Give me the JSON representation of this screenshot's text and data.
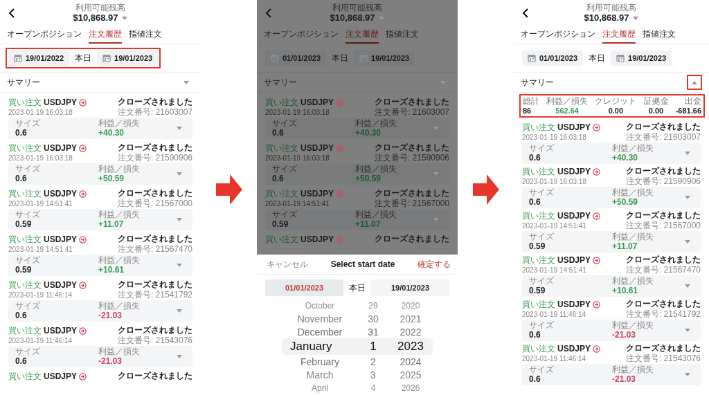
{
  "screens": [
    {
      "dimmed": false,
      "header": {
        "label": "利用可能残高",
        "balance": "$10,868.97"
      },
      "tabs": [
        {
          "label": "オープンポジション",
          "selected": false
        },
        {
          "label": "注文履歴",
          "selected": true
        },
        {
          "label": "指値注文",
          "selected": false
        }
      ],
      "date_range": {
        "start": "19/01/2022",
        "today": "本日",
        "end": "19/01/2023",
        "highlighted": true
      },
      "summary": {
        "label": "サマリー",
        "expanded": false,
        "toggle_highlighted": false
      },
      "orders": [
        {
          "side": "買い注文",
          "symbol": "USDJPY",
          "time": "2023-01-19 16:03:18",
          "status": "クローズされました",
          "order_no": "注文番号: 21603007",
          "size_label": "サイズ",
          "size": "0.6",
          "pl_label": "利益／損失",
          "pl": "+40.30",
          "color": "#3c9a55"
        },
        {
          "side": "買い注文",
          "symbol": "USDJPY",
          "time": "2023-01-19 16:03:18",
          "status": "クローズされました",
          "order_no": "注文番号: 21590906",
          "size_label": "サイズ",
          "size": "0.6",
          "pl_label": "利益／損失",
          "pl": "+50.59",
          "color": "#3c9a55"
        },
        {
          "side": "買い注文",
          "symbol": "USDJPY",
          "time": "2023-01-19 14:51:41",
          "status": "クローズされました",
          "order_no": "注文番号: 21567000",
          "size_label": "サイズ",
          "size": "0.59",
          "pl_label": "利益／損失",
          "pl": "+11.07",
          "color": "#3c9a55"
        },
        {
          "side": "買い注文",
          "symbol": "USDJPY",
          "time": "2023-01-19 14:51:41",
          "status": "クローズされました",
          "order_no": "注文番号: 21567470",
          "size_label": "サイズ",
          "size": "0.59",
          "pl_label": "利益／損失",
          "pl": "+10.61",
          "color": "#3c9a55"
        },
        {
          "side": "買い注文",
          "symbol": "USDJPY",
          "time": "2023-01-19 11:46:14",
          "status": "クローズされました",
          "order_no": "注文番号: 21541792",
          "size_label": "サイズ",
          "size": "0.6",
          "pl_label": "利益／損失",
          "pl": "-21.03",
          "color": "#d0435b"
        },
        {
          "side": "買い注文",
          "symbol": "USDJPY",
          "time": "2023-01-19 11:46:14",
          "status": "クローズされました",
          "order_no": "注文番号: 21543076",
          "size_label": "サイズ",
          "size": "0.6",
          "pl_label": "利益／損失",
          "pl": "-21.03",
          "color": "#d0435b"
        },
        {
          "side": "買い注文",
          "symbol": "USDJPY",
          "status": "クローズされました"
        }
      ]
    },
    {
      "dimmed": true,
      "header": {
        "label": "利用可能残高",
        "balance": "$10,868.97"
      },
      "tabs": [
        {
          "label": "オープンポジション",
          "selected": false
        },
        {
          "label": "注文履歴",
          "selected": true
        },
        {
          "label": "指値注文",
          "selected": false
        }
      ],
      "date_range": {
        "start": "01/01/2023",
        "today": "本日",
        "end": "19/01/2023",
        "highlighted": false
      },
      "summary": {
        "label": "サマリー",
        "expanded": false,
        "toggle_highlighted": false
      },
      "orders": [
        {
          "side": "買い注文",
          "symbol": "USDJPY",
          "time": "2023-01-19 16:03:18",
          "status": "クローズされました",
          "order_no": "注文番号: 21603007",
          "size_label": "サイズ",
          "size": "0.6",
          "pl_label": "利益／損失",
          "pl": "+40.30",
          "color": "#1e5a2e"
        },
        {
          "side": "買い注文",
          "symbol": "USDJPY",
          "time": "2023-01-19 16:03:18",
          "status": "クローズされました",
          "order_no": "注文番号: 21590906",
          "size_label": "サイズ",
          "size": "0.6",
          "pl_label": "利益／損失",
          "pl": "+50.59",
          "color": "#1e5a2e"
        },
        {
          "side": "買い注文",
          "symbol": "USDJPY",
          "time": "2023-01-19 14:51:41",
          "status": "クローズされました",
          "order_no": "注文番号: 21567000",
          "size_label": "サイズ",
          "size": "0.59",
          "pl_label": "利益／損失",
          "pl": "+11.07",
          "color": "#1e5a2e"
        },
        {
          "side": "買い注文",
          "symbol": "USDJPY",
          "status": "クローズされました"
        }
      ],
      "date_picker": {
        "cancel": "キャンセル",
        "title": "Select start date",
        "confirm": "確定する",
        "start": {
          "label": "01/01/2023",
          "selected": true
        },
        "today": "本日",
        "end": {
          "label": "19/01/2023",
          "selected": false
        },
        "rows": [
          {
            "month": "October",
            "day": "29",
            "year": "2020",
            "selected": false
          },
          {
            "month": "November",
            "day": "30",
            "year": "2021",
            "selected": false
          },
          {
            "month": "December",
            "day": "31",
            "year": "2022",
            "selected": false
          },
          {
            "month": "January",
            "day": "1",
            "year": "2023",
            "selected": true
          },
          {
            "month": "February",
            "day": "2",
            "year": "2024",
            "selected": false
          },
          {
            "month": "March",
            "day": "3",
            "year": "2025",
            "selected": false
          },
          {
            "month": "April",
            "day": "4",
            "year": "2026",
            "selected": false
          }
        ]
      }
    },
    {
      "dimmed": false,
      "header": {
        "label": "利用可能残高",
        "balance": "$10,868.97"
      },
      "tabs": [
        {
          "label": "オープンポジション",
          "selected": false
        },
        {
          "label": "注文履歴",
          "selected": true
        },
        {
          "label": "指値注文",
          "selected": false
        }
      ],
      "date_range": {
        "start": "01/01/2023",
        "today": "本日",
        "end": "19/01/2023",
        "highlighted": false
      },
      "summary": {
        "label": "サマリー",
        "expanded": true,
        "toggle_highlighted": true,
        "stats_highlighted": true,
        "stats": [
          {
            "label": "総計",
            "value": "86",
            "color": "#222222"
          },
          {
            "label": "利益／損失",
            "value": "562.64",
            "color": "#3c9a55"
          },
          {
            "label": "クレジット",
            "value": "0.00",
            "color": "#222222"
          },
          {
            "label": "証拠金",
            "value": "0.00",
            "color": "#222222"
          },
          {
            "label": "出金",
            "value": "-681.66",
            "color": "#222222"
          }
        ]
      },
      "orders": [
        {
          "side": "買い注文",
          "symbol": "USDJPY",
          "time": "2023-01-19 16:03:18",
          "status": "クローズされました",
          "order_no": "注文番号: 21603007",
          "size_label": "サイズ",
          "size": "0.6",
          "pl_label": "利益／損失",
          "pl": "+40.30",
          "color": "#3c9a55"
        },
        {
          "side": "買い注文",
          "symbol": "USDJPY",
          "time": "2023-01-19 16:03:18",
          "status": "クローズされました",
          "order_no": "注文番号: 21590906",
          "size_label": "サイズ",
          "size": "0.6",
          "pl_label": "利益／損失",
          "pl": "+50.59",
          "color": "#3c9a55"
        },
        {
          "side": "買い注文",
          "symbol": "USDJPY",
          "time": "2023-01-19 14:51:41",
          "status": "クローズされました",
          "order_no": "注文番号: 21567000",
          "size_label": "サイズ",
          "size": "0.59",
          "pl_label": "利益／損失",
          "pl": "+11.07",
          "color": "#3c9a55"
        },
        {
          "side": "買い注文",
          "symbol": "USDJPY",
          "time": "2023-01-19 14:51:41",
          "status": "クローズされました",
          "order_no": "注文番号: 21567470",
          "size_label": "サイズ",
          "size": "0.59",
          "pl_label": "利益／損失",
          "pl": "+10.61",
          "color": "#3c9a55"
        },
        {
          "side": "買い注文",
          "symbol": "USDJPY",
          "time": "2023-01-19 11:46:14",
          "status": "クローズされました",
          "order_no": "注文番号: 21541792",
          "size_label": "サイズ",
          "size": "0.6",
          "pl_label": "利益／損失",
          "pl": "-21.03",
          "color": "#d0435b"
        },
        {
          "side": "買い注文",
          "symbol": "USDJPY",
          "time": "2023-01-19 11:46:14",
          "status": "クローズされました",
          "order_no": "注文番号: 21543076",
          "size_label": "サイズ",
          "size": "0.6",
          "pl_label": "利益／損失",
          "pl": "-21.03",
          "color": "#d0435b"
        }
      ]
    }
  ]
}
